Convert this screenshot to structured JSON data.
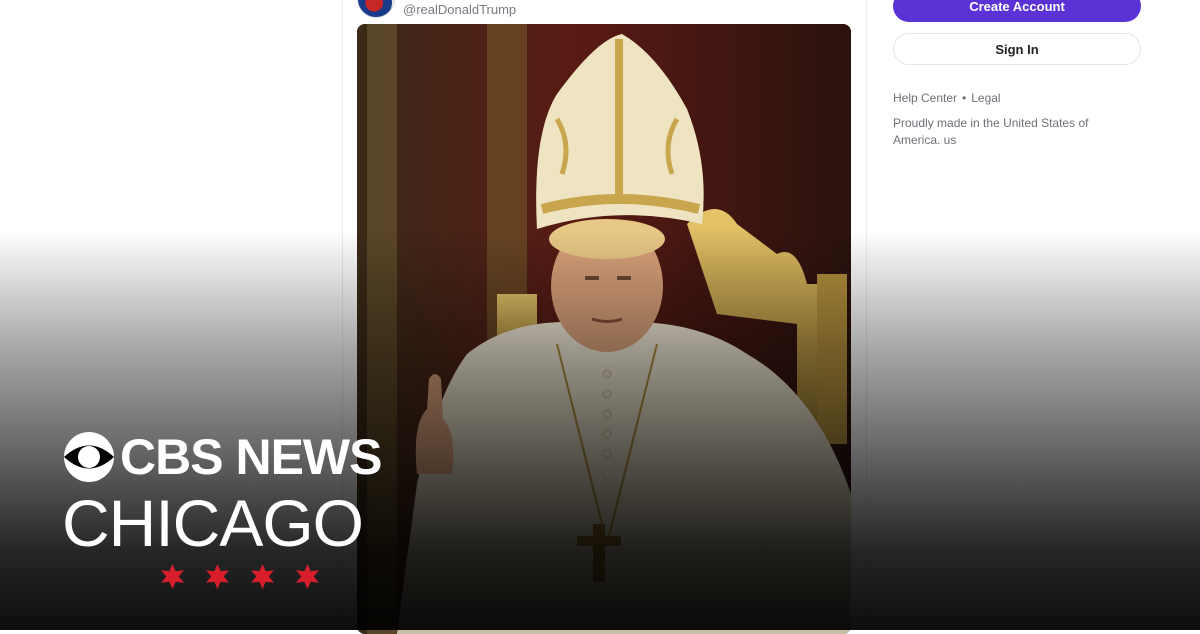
{
  "post": {
    "handle": "@realDonaldTrump",
    "image_subject": "pope-portrait"
  },
  "sidebar": {
    "create_account_label": "Create Account",
    "sign_in_label": "Sign In",
    "help_center_label": "Help Center",
    "separator": "•",
    "legal_label": "Legal",
    "made_in_text": "Proudly made in the United States of America. us"
  },
  "branding": {
    "network": "CBS NEWS",
    "city": "CHICAGO",
    "star_count": 4,
    "star_color": "#d81e2b"
  },
  "colors": {
    "accent": "#5b32d6",
    "muted_text": "#6f6f78"
  }
}
